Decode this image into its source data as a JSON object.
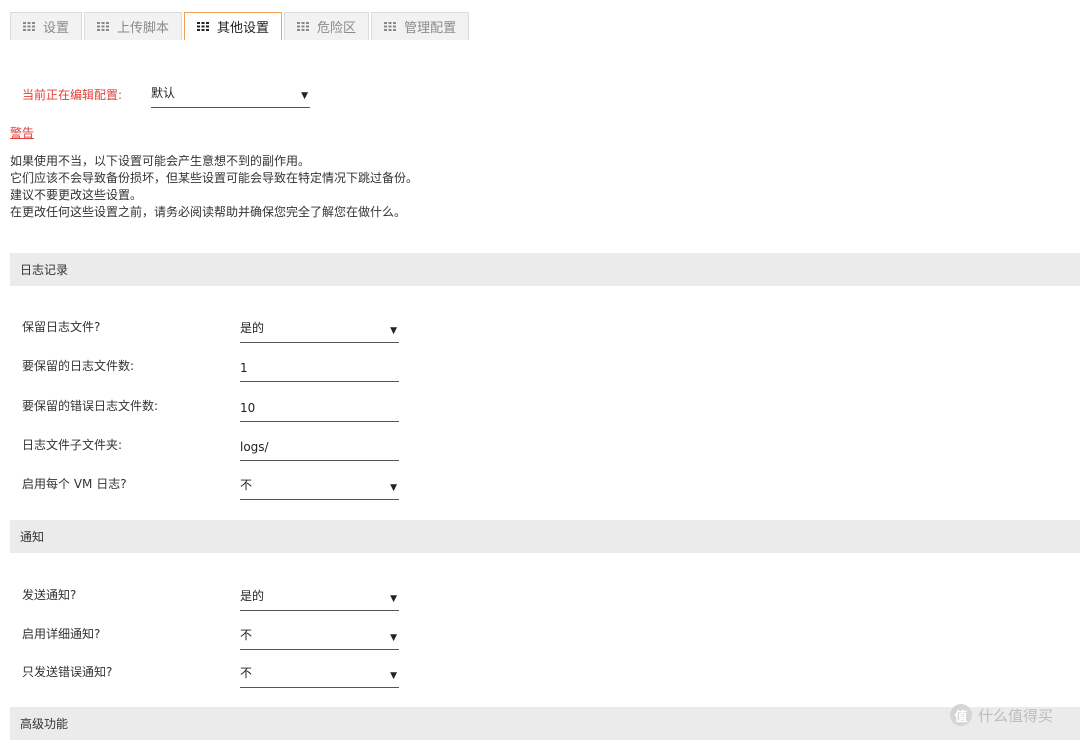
{
  "tabs": [
    {
      "label": "设置",
      "active": false,
      "icon": "grid-icon"
    },
    {
      "label": "上传脚本",
      "active": false,
      "icon": "grid-icon"
    },
    {
      "label": "其他设置",
      "active": true,
      "icon": "grid-icon"
    },
    {
      "label": "危险区",
      "active": false,
      "icon": "grid-icon"
    },
    {
      "label": "管理配置",
      "active": false,
      "icon": "grid-icon"
    }
  ],
  "config": {
    "label": "当前正在编辑配置:",
    "value": "默认"
  },
  "warning": {
    "title": "警告",
    "lines": [
      "如果使用不当，以下设置可能会产生意想不到的副作用。",
      "它们应该不会导致备份损坏，但某些设置可能会导致在特定情况下跳过备份。",
      "建议不要更改这些设置。",
      "在更改任何这些设置之前，请务必阅读帮助并确保您完全了解您在做什么。"
    ]
  },
  "sections": {
    "logging": {
      "title": "日志记录",
      "rows": [
        {
          "label": "保留日志文件?",
          "value": "是的",
          "type": "select"
        },
        {
          "label": "要保留的日志文件数:",
          "value": "1",
          "type": "input"
        },
        {
          "label": "要保留的错误日志文件数:",
          "value": "10",
          "type": "input"
        },
        {
          "label": "日志文件子文件夹:",
          "value": "logs/",
          "type": "input"
        },
        {
          "label": "启用每个 VM 日志?",
          "value": "不",
          "type": "select"
        }
      ]
    },
    "notify": {
      "title": "通知",
      "rows": [
        {
          "label": "发送通知?",
          "value": "是的",
          "type": "select"
        },
        {
          "label": "启用详细通知?",
          "value": "不",
          "type": "select"
        },
        {
          "label": "只发送错误通知?",
          "value": "不",
          "type": "select"
        }
      ]
    },
    "advanced": {
      "title": "高级功能"
    }
  },
  "watermark": {
    "logo": "值",
    "text": "什么值得买"
  },
  "colors": {
    "accent_tab_border": "#f0a050",
    "warning_red": "#e0403a",
    "section_bg": "#ebebeb"
  }
}
